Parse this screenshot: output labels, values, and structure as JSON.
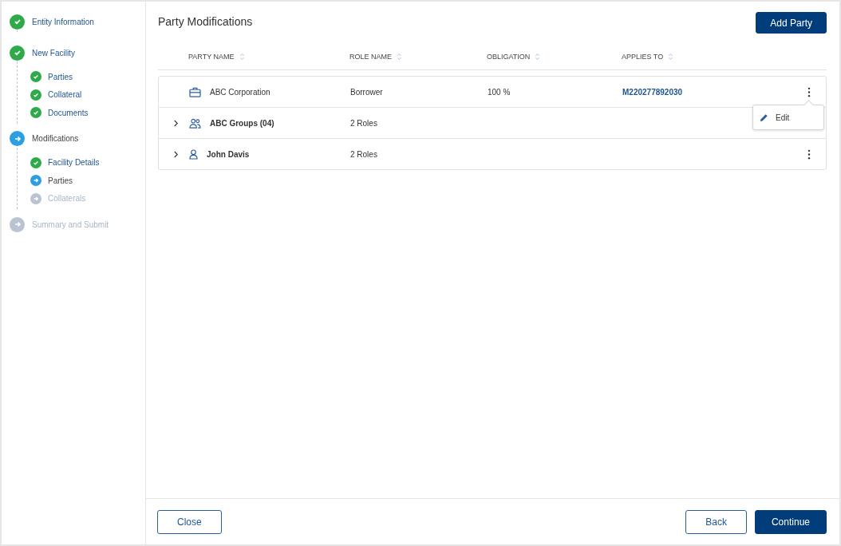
{
  "steps": [
    {
      "label": "Entity Information",
      "kind": "done"
    },
    {
      "label": "New Facility",
      "kind": "done",
      "children": [
        {
          "label": "Parties",
          "kind": "done"
        },
        {
          "label": "Collateral",
          "kind": "done"
        },
        {
          "label": "Documents",
          "kind": "done"
        }
      ]
    },
    {
      "label": "Modifications",
      "kind": "current",
      "children": [
        {
          "label": "Facility Details",
          "kind": "done"
        },
        {
          "label": "Parties",
          "kind": "current"
        },
        {
          "label": "Collaterals",
          "kind": "pending"
        }
      ]
    },
    {
      "label": "Summary and Submit",
      "kind": "pending"
    }
  ],
  "title": "Party Modifications",
  "add_button": "Add Party",
  "columns": [
    "PARTY NAME",
    "ROLE NAME",
    "OBLIGATION",
    "APPLIES TO"
  ],
  "rows": [
    {
      "kind": "company",
      "expandable": false,
      "name": "ABC Corporation",
      "role": "Borrower",
      "obligation": "100 %",
      "applies_to": "M220277892030",
      "menu": [
        "Edit"
      ]
    },
    {
      "kind": "group",
      "expandable": true,
      "name": "ABC Groups (04)",
      "role": "2 Roles"
    },
    {
      "kind": "person",
      "expandable": true,
      "name": "John Davis",
      "role": "2 Roles"
    }
  ],
  "footer": {
    "close": "Close",
    "back": "Back",
    "continue": "Continue"
  }
}
